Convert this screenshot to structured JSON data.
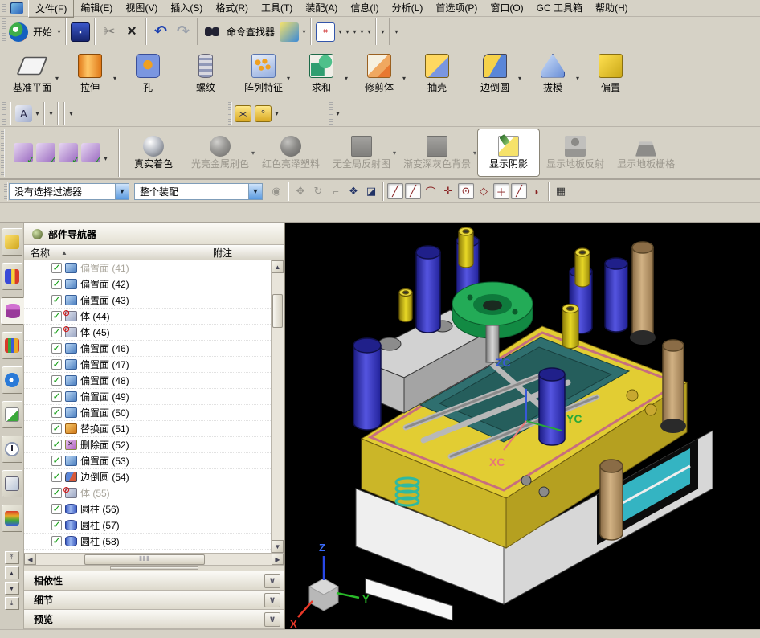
{
  "menu": {
    "items": [
      "文件(F)",
      "编辑(E)",
      "视图(V)",
      "插入(S)",
      "格式(R)",
      "工具(T)",
      "装配(A)",
      "信息(I)",
      "分析(L)",
      "首选项(P)",
      "窗口(O)",
      "GC 工具箱",
      "帮助(H)"
    ]
  },
  "toolbar_standard": {
    "start_label": "开始",
    "command_finder_label": "命令查找器",
    "file_group": [
      {
        "name": "new-file-icon"
      },
      {
        "name": "open-folder-icon"
      },
      {
        "name": "save-icon",
        "glyph": "▪"
      }
    ],
    "edit_group": [
      {
        "name": "scissors-icon",
        "glyph": "✂",
        "state": "dis"
      },
      {
        "name": "copy-icon",
        "state": "dis"
      },
      {
        "name": "paste-icon",
        "state": "dis"
      },
      {
        "name": "delete-icon",
        "glyph": "×"
      }
    ],
    "undo_group": [
      {
        "name": "undo-icon",
        "glyph": "↶"
      },
      {
        "name": "redo-icon",
        "glyph": "↷"
      }
    ],
    "view_group": [
      {
        "name": "fit-view-icon",
        "glyph": "⌗",
        "arrow": "▾"
      },
      {
        "name": "laptop-icon",
        "arrow": "▾"
      },
      {
        "name": "view-cube-icon",
        "arrow": "▾"
      },
      {
        "name": "shaded-style-icon",
        "arrow": "▾"
      },
      {
        "name": "clip-section-icon"
      },
      {
        "name": "clip-section-2-icon",
        "arrow": "▾"
      }
    ],
    "tool_group": [
      {
        "name": "roles-icon"
      },
      {
        "name": "move-object-icon",
        "arrow": "▾"
      }
    ],
    "measure_group": [
      {
        "name": "constraint-icon",
        "arrow": "▾"
      },
      {
        "name": "measure-ruler-icon"
      }
    ]
  },
  "toolbar_features": {
    "buttons": [
      {
        "label": "基准平面",
        "icon": "datum-plane",
        "arrow": "▾",
        "name": "datum-plane-button"
      },
      {
        "label": "拉伸",
        "icon": "extrude",
        "arrow": "▾",
        "name": "extrude-button"
      },
      {
        "label": "孔",
        "icon": "hole",
        "arrow": "",
        "name": "hole-button"
      },
      {
        "label": "螺纹",
        "icon": "thread",
        "arrow": "",
        "name": "thread-button"
      },
      {
        "label": "阵列特征",
        "icon": "pattern",
        "arrow": "▾",
        "name": "pattern-feature-button"
      },
      {
        "label": "求和",
        "icon": "unite",
        "arrow": "▾",
        "name": "unite-button"
      },
      {
        "label": "修剪体",
        "icon": "trim",
        "arrow": "▾",
        "name": "trim-body-button"
      },
      {
        "label": "抽壳",
        "icon": "shell",
        "arrow": "",
        "name": "shell-button"
      },
      {
        "label": "边倒圆",
        "icon": "blend-edge",
        "arrow": "▾",
        "name": "edge-blend-button"
      },
      {
        "label": "拔模",
        "icon": "draft",
        "arrow": "▾",
        "name": "draft-button"
      },
      {
        "label": "偏置",
        "icon": "offset",
        "arrow": "",
        "name": "offset-button"
      }
    ]
  },
  "toolbar_small": {
    "group_a": [
      {
        "name": "select-rect-icon"
      },
      {
        "name": "layers-icon"
      },
      {
        "name": "layer-settings-icon"
      },
      {
        "name": "note-icon"
      }
    ],
    "group_b": [
      {
        "name": "check-feature-icon"
      },
      {
        "name": "check-tool-icon"
      },
      {
        "name": "check-body-icon"
      },
      {
        "name": "text-abc-icon",
        "glyph": "A",
        "arrow": "▾"
      }
    ],
    "group_c": [
      {
        "name": "surface-reflect-icon"
      },
      {
        "name": "surface-slope-icon"
      },
      {
        "name": "gauge-hand-icon",
        "arrow": "▾"
      }
    ],
    "group_d": [
      {
        "name": "spring-icon"
      },
      {
        "name": "washer-icon"
      }
    ],
    "group_e": [
      {
        "name": "brush-icon",
        "arrow": "▾"
      }
    ],
    "group_f": [
      {
        "name": "draft-triangle-icon"
      },
      {
        "name": "grid-table-icon"
      },
      {
        "name": "folder-points-icon",
        "glyph": "＊"
      },
      {
        "name": "folder-circles-icon",
        "glyph": "°",
        "arrow": "▾"
      }
    ],
    "group_g": [
      {
        "name": "lock-a-icon"
      },
      {
        "name": "lock-b-icon",
        "arrow": "▾"
      }
    ]
  },
  "toolbar_render": {
    "left_icons": [
      {
        "name": "visual-check-icon"
      },
      {
        "name": "visual-list-icon"
      },
      {
        "name": "visual-table-icon"
      },
      {
        "name": "visual-axes-icon",
        "arrow": "▾"
      }
    ],
    "buttons": [
      {
        "label": "真实着色",
        "icon": "sphere-silver",
        "state": "on",
        "arrow": "",
        "name": "true-shading-button"
      },
      {
        "label": "光亮金属刷色",
        "icon": "sphere-metal",
        "state": "off",
        "arrow": "▾",
        "name": "brushed-metal-button"
      },
      {
        "label": "红色亮泽塑料",
        "icon": "sphere-red",
        "state": "off",
        "arrow": "",
        "name": "red-plastic-button"
      },
      {
        "label": "无全局反射图",
        "icon": "square-flat",
        "state": "off",
        "arrow": "▾",
        "name": "no-reflection-button"
      },
      {
        "label": "渐变深灰色背景",
        "icon": "square-flat",
        "state": "off",
        "arrow": "▾",
        "name": "gradient-background-button"
      },
      {
        "label": "显示阴影",
        "icon": "shadow-pen",
        "state": "active",
        "arrow": "",
        "name": "show-shadow-button"
      },
      {
        "label": "显示地板反射",
        "icon": "person-floor",
        "state": "off",
        "arrow": "",
        "name": "floor-reflection-button"
      },
      {
        "label": "显示地板栅格",
        "icon": "floor-grid",
        "state": "off",
        "arrow": "",
        "name": "floor-grid-button"
      }
    ]
  },
  "selection_bar": {
    "filter_value": "没有选择过滤器",
    "scope_value": "整个装配",
    "snaps_a": [
      {
        "name": "rollover-icon",
        "glyph": "◉",
        "state": "dis"
      }
    ],
    "snaps_b": [
      {
        "name": "snap-handle-icon",
        "glyph": "✥",
        "state": "dis"
      },
      {
        "name": "snap-rotate-icon",
        "glyph": "↻",
        "state": "dis"
      },
      {
        "name": "snap-hook-icon",
        "glyph": "⌐",
        "state": "dis"
      }
    ],
    "snaps_c": [
      {
        "name": "painter-icon",
        "glyph": "❖"
      },
      {
        "name": "show-box-icon",
        "glyph": "◪"
      }
    ],
    "snaps_d": [
      {
        "name": "snap-endpoint-icon",
        "glyph": "╱",
        "state": "pressed"
      },
      {
        "name": "snap-midpoint-icon",
        "glyph": "╱",
        "state": "pressed"
      },
      {
        "name": "snap-tangent-icon",
        "glyph": "⌒"
      },
      {
        "name": "snap-intersection-icon",
        "glyph": "✛"
      },
      {
        "name": "snap-center-icon",
        "glyph": "⊙",
        "state": "pressed"
      },
      {
        "name": "snap-quadrant-icon",
        "glyph": "◇"
      },
      {
        "name": "snap-point-icon",
        "glyph": "＋",
        "state": "pressed"
      },
      {
        "name": "snap-point-on-curve-icon",
        "glyph": "╱",
        "state": "pressed"
      },
      {
        "name": "snap-face-icon",
        "glyph": "◗"
      }
    ],
    "snaps_e": [
      {
        "name": "grid-snap-icon",
        "glyph": "▦"
      }
    ]
  },
  "resource_bar": {
    "tabs": [
      {
        "name": "assembly-navigator-tab",
        "icon": "asm",
        "state": ""
      },
      {
        "name": "constraint-navigator-tab",
        "icon": "constr",
        "state": ""
      },
      {
        "name": "part-navigator-tab",
        "icon": "part",
        "state": "active"
      },
      {
        "name": "reuse-library-tab",
        "icon": "lib",
        "state": ""
      },
      {
        "name": "internet-explorer-tab",
        "icon": "info",
        "state": ""
      },
      {
        "name": "web-browser-tab",
        "icon": "webdoc",
        "state": ""
      },
      {
        "name": "history-tab",
        "icon": "clock",
        "state": ""
      },
      {
        "name": "system-scenes-tab",
        "icon": "palette",
        "state": ""
      },
      {
        "name": "materials-tab",
        "icon": "wand",
        "state": ""
      }
    ],
    "nav_buttons": [
      {
        "name": "res-top-icon",
        "glyph": "⤒"
      },
      {
        "name": "res-up-icon",
        "glyph": "▲"
      },
      {
        "name": "res-down-icon",
        "glyph": "▼"
      },
      {
        "name": "res-bottom-icon",
        "glyph": "⤓"
      }
    ]
  },
  "navigator": {
    "title": "部件导航器",
    "col_name": "名称",
    "col_note": "附注",
    "sort_glyph": "▲",
    "items": [
      {
        "label": "偏置面 (41)",
        "icon": "offset-face",
        "check": "✓",
        "state": "muted"
      },
      {
        "label": "偏置面 (42)",
        "icon": "offset-face",
        "check": "✓",
        "state": ""
      },
      {
        "label": "偏置面 (43)",
        "icon": "offset-face",
        "check": "✓",
        "state": ""
      },
      {
        "label": "体 (44)",
        "icon": "body",
        "check": "✓",
        "state": ""
      },
      {
        "label": "体 (45)",
        "icon": "body",
        "check": "✓",
        "state": ""
      },
      {
        "label": "偏置面 (46)",
        "icon": "offset-face",
        "check": "✓",
        "state": ""
      },
      {
        "label": "偏置面 (47)",
        "icon": "offset-face",
        "check": "✓",
        "state": ""
      },
      {
        "label": "偏置面 (48)",
        "icon": "offset-face",
        "check": "✓",
        "state": ""
      },
      {
        "label": "偏置面 (49)",
        "icon": "offset-face",
        "check": "✓",
        "state": ""
      },
      {
        "label": "偏置面 (50)",
        "icon": "offset-face",
        "check": "✓",
        "state": ""
      },
      {
        "label": "替换面 (51)",
        "icon": "replace-face",
        "check": "✓",
        "state": ""
      },
      {
        "label": "删除面 (52)",
        "icon": "delete-face",
        "check": "✓",
        "state": ""
      },
      {
        "label": "偏置面 (53)",
        "icon": "offset-face",
        "check": "✓",
        "state": ""
      },
      {
        "label": "边倒圆 (54)",
        "icon": "blend",
        "check": "✓",
        "state": ""
      },
      {
        "label": "体 (55)",
        "icon": "body",
        "check": "✓",
        "state": "muted"
      },
      {
        "label": "圆柱 (56)",
        "icon": "cylinder",
        "check": "✓",
        "state": ""
      },
      {
        "label": "圆柱 (57)",
        "icon": "cylinder",
        "check": "✓",
        "state": ""
      },
      {
        "label": "圆柱 (58)",
        "icon": "cylinder",
        "check": "✓",
        "state": ""
      }
    ],
    "panels": [
      "相依性",
      "细节",
      "预览"
    ],
    "chevron_glyph": "∨",
    "scroll_up_glyph": "▲",
    "scroll_down_glyph": "▼",
    "scroll_left_glyph": "◀",
    "scroll_right_glyph": "▶",
    "hthumb_glyph": "⦀⦀⦀"
  },
  "viewport": {
    "wcs": {
      "x": "XC",
      "y": "YC",
      "z": "ZC"
    },
    "triad": {
      "x": "X",
      "y": "Y",
      "z": "Z"
    }
  }
}
